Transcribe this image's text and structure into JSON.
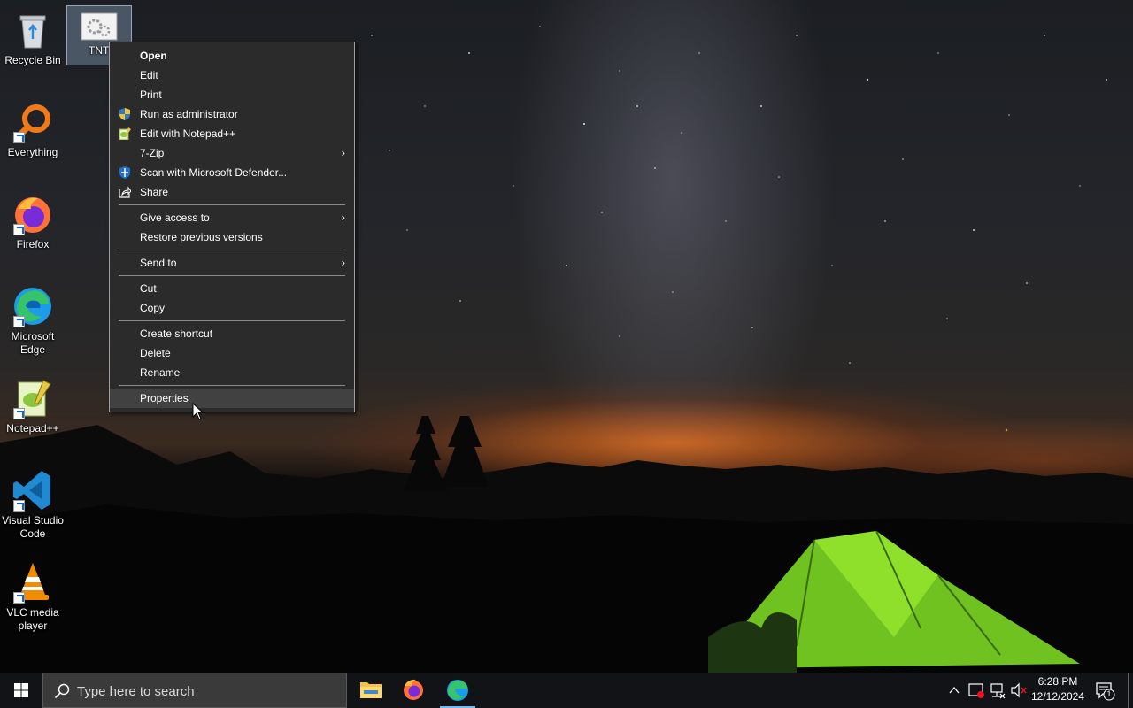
{
  "desktop": {
    "icons": [
      {
        "label": "Recycle Bin",
        "icon": "recycle-bin-icon"
      },
      {
        "label": "TNT",
        "icon": "settings-file-icon"
      },
      {
        "label": "Everything",
        "icon": "everything-search-icon"
      },
      {
        "label": "Firefox",
        "icon": "firefox-icon"
      },
      {
        "label": "Microsoft Edge",
        "icon": "edge-icon"
      },
      {
        "label": "Notepad++",
        "icon": "notepadpp-icon"
      },
      {
        "label": "Visual Studio Code",
        "icon": "vscode-icon"
      },
      {
        "label": "VLC media player",
        "icon": "vlc-icon"
      }
    ]
  },
  "context_menu": {
    "items": [
      {
        "label": "Open"
      },
      {
        "label": "Edit"
      },
      {
        "label": "Print"
      },
      {
        "label": "Run as administrator",
        "icon": "uac-shield-icon"
      },
      {
        "label": "Edit with Notepad++",
        "icon": "notepadpp-icon"
      },
      {
        "label": "7-Zip",
        "submenu": true
      },
      {
        "label": "Scan with Microsoft Defender...",
        "icon": "defender-icon"
      },
      {
        "label": "Share",
        "icon": "share-icon"
      },
      {
        "label": "Give access to",
        "submenu": true
      },
      {
        "label": "Restore previous versions"
      },
      {
        "label": "Send to",
        "submenu": true
      },
      {
        "label": "Cut"
      },
      {
        "label": "Copy"
      },
      {
        "label": "Create shortcut"
      },
      {
        "label": "Delete"
      },
      {
        "label": "Rename"
      },
      {
        "label": "Properties"
      }
    ],
    "submenu_arrow": "›"
  },
  "taskbar": {
    "search_placeholder": "Type here to search",
    "apps": [
      {
        "name": "File Explorer",
        "icon": "file-explorer-icon"
      },
      {
        "name": "Firefox",
        "icon": "firefox-icon"
      },
      {
        "name": "Microsoft Edge",
        "icon": "edge-icon"
      }
    ],
    "clock_time": "6:28 PM",
    "clock_date": "12/12/2024",
    "notification_count": "1"
  },
  "colors": {
    "menu_bg": "#2b2b2b",
    "menu_hover": "#414141",
    "taskbar_bg": "#111316",
    "accent": "#76b9ed"
  }
}
